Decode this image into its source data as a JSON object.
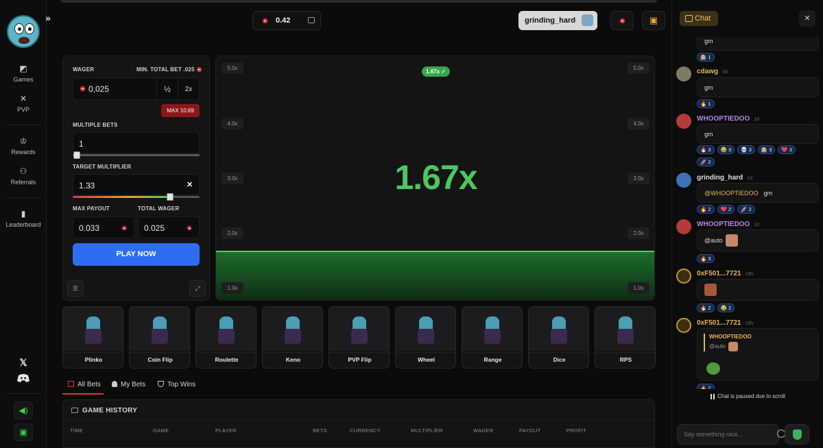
{
  "sidebar": {
    "items": [
      {
        "label": "Games",
        "icon": "dice-icon"
      },
      {
        "label": "PVP",
        "icon": "swords-icon"
      },
      {
        "label": "Rewards",
        "icon": "trophy-icon"
      },
      {
        "label": "Referrals",
        "icon": "users-icon"
      },
      {
        "label": "Leaderboard",
        "icon": "bar-chart-icon"
      }
    ],
    "social": {
      "x": "𝕏",
      "discord": "discord-icon"
    },
    "sound_icon": "speaker-icon",
    "ticket_icon": "ticket-icon"
  },
  "header": {
    "balance": "0.42",
    "username": "grinding_hard"
  },
  "wager": {
    "label": "WAGER",
    "min_label": "MIN. TOTAL BET .025",
    "value": "0,025",
    "half": "½",
    "double": "2x",
    "max": "MAX 10.69"
  },
  "multiple_bets": {
    "label": "MULTIPLE BETS",
    "value": "1",
    "level": 0
  },
  "target": {
    "label": "TARGET MULTIPLIER",
    "value": "1.33",
    "clear": "✕",
    "level": 0.75
  },
  "max_payout": {
    "label": "MAX PAYOUT",
    "value": "0.033"
  },
  "total_wager": {
    "label": "TOTAL WAGER",
    "value": "0.025"
  },
  "play_label": "PLAY NOW",
  "game": {
    "multiplier": "1.67x",
    "badge": "1.67x ✓",
    "y_labels": [
      "5.0x",
      "4.0x",
      "3.0x",
      "2.0x",
      "1.0x"
    ]
  },
  "tiles": [
    "Plinko",
    "Coin Flip",
    "Roulette",
    "Keno",
    "PVP Flip",
    "Wheel",
    "Range",
    "Dice",
    "RPS"
  ],
  "bet_tabs": [
    "All Bets",
    "My Bets",
    "Top Wins"
  ],
  "history": {
    "title": "GAME HISTORY",
    "columns": [
      "TIME",
      "GAME",
      "PLAYER",
      "BETS",
      "CURRENCY",
      "MULTIPLIER",
      "WAGER",
      "PAYOUT",
      "PROFIT"
    ]
  },
  "chat": {
    "tab": "Chat",
    "close": "✕",
    "messages": [
      {
        "user": "",
        "time": "",
        "text": "gm",
        "reactions": [
          "🎰 1"
        ]
      },
      {
        "user": "cdawg",
        "time": "3d",
        "text": "gm",
        "reactions": [
          "🔥 1"
        ]
      },
      {
        "user": "WHOOPTIEDOO",
        "time": "1d",
        "text": "gm",
        "reactions": [
          "🔥 3",
          "😂 3",
          "💀 3",
          "🎰 3",
          "❤️ 3",
          "🚀 2"
        ]
      },
      {
        "user": "grinding_hard",
        "time": "1d",
        "mention": "@WHOOPTIEDOO",
        "text": "gm",
        "reactions": [
          "🔥 2",
          "❤️ 2",
          "🚀 2"
        ]
      },
      {
        "user": "WHOOPTIEDOO",
        "time": "1d",
        "text": "@auto",
        "reactions": [
          "🔥 3"
        ]
      },
      {
        "user": "0xF501...7721",
        "time": "19h",
        "text": "",
        "reactions": [
          "🔥 2",
          "😂 2"
        ]
      },
      {
        "user": "0xF501...7721",
        "time": "19h",
        "quote_user": "WHOOPTIEDOO",
        "quote_text": "@auto",
        "text": "",
        "reactions": [
          "🔥 2"
        ]
      }
    ],
    "paused": "Chat is paused due to scroll",
    "placeholder": "Say something nice..."
  },
  "colors": {
    "accent_green": "#4cc75f",
    "play_blue": "#2e6cf0",
    "max_red": "#8a1818",
    "chat_gold": "#e8c062"
  }
}
